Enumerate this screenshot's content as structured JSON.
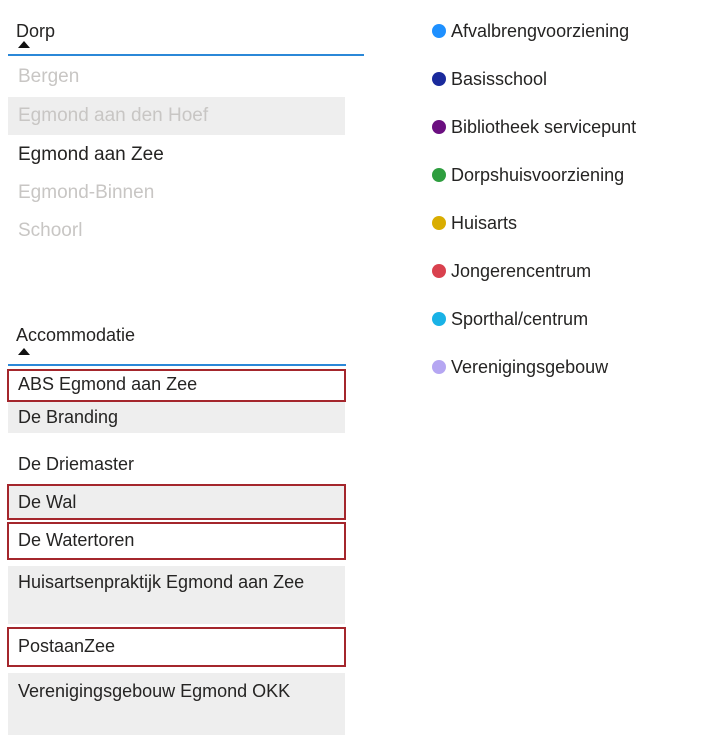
{
  "dorp_slicer": {
    "title": "Dorp",
    "items": [
      {
        "label": "Bergen",
        "state": "dim"
      },
      {
        "label": "Egmond aan den Hoef",
        "state": "dim"
      },
      {
        "label": "Egmond aan Zee",
        "state": "selected"
      },
      {
        "label": "Egmond-Binnen",
        "state": "dim"
      },
      {
        "label": "Schoorl",
        "state": "dim"
      }
    ]
  },
  "accommodatie_slicer": {
    "title": "Accommodatie",
    "items": [
      {
        "label": "ABS Egmond aan Zee",
        "highlighted": true
      },
      {
        "label": "De Branding",
        "highlighted": false
      },
      {
        "label": "De Driemaster",
        "highlighted": false
      },
      {
        "label": "De Wal",
        "highlighted": true
      },
      {
        "label": "De Watertoren",
        "highlighted": true
      },
      {
        "label": "Huisartsenpraktijk Egmond aan Zee",
        "highlighted": false
      },
      {
        "label": "PostaanZee",
        "highlighted": true
      },
      {
        "label": "Verenigingsgebouw Egmond OKK",
        "highlighted": false
      }
    ]
  },
  "legend": {
    "items": [
      {
        "label": "Afvalbrengvoorziening",
        "color": "#1e90ff"
      },
      {
        "label": "Basisschool",
        "color": "#1a2a9c"
      },
      {
        "label": "Bibliotheek servicepunt",
        "color": "#6b0f80"
      },
      {
        "label": "Dorpshuisvoorziening",
        "color": "#2e9e3f"
      },
      {
        "label": "Huisarts",
        "color": "#d9ad00"
      },
      {
        "label": "Jongerencentrum",
        "color": "#d9414e"
      },
      {
        "label": "Sporthal/centrum",
        "color": "#19b2e6"
      },
      {
        "label": "Verenigingsgebouw",
        "color": "#b5a6f2"
      }
    ]
  },
  "colors": {
    "accent_underline": "#2b88d8",
    "highlight_border": "#a4262c",
    "row_shade": "#eeeeee",
    "dim_text": "#c8c6c4"
  }
}
